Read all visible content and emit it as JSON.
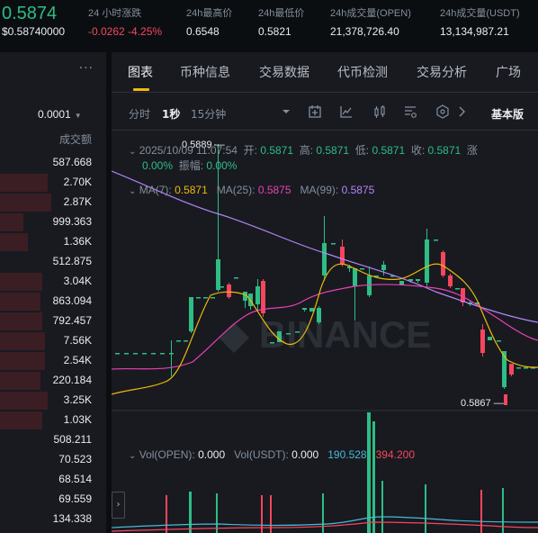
{
  "header": {
    "last_price": "0.5874",
    "last_price_usd": "$0.58740000",
    "stats": [
      {
        "label": "24 小时涨跌",
        "value": "-0.0262 -4.25%",
        "color": "#f6465d"
      },
      {
        "label": "24h最高价",
        "value": "0.6548",
        "color": "#eaecef"
      },
      {
        "label": "24h最低价",
        "value": "0.5821",
        "color": "#eaecef"
      },
      {
        "label": "24h成交量(OPEN)",
        "value": "21,378,726.40",
        "color": "#eaecef"
      },
      {
        "label": "24h成交量(USDT)",
        "value": "13,134,987.21",
        "color": "#eaecef"
      }
    ]
  },
  "orderbook": {
    "more_icon": "ellipsis-icon",
    "tick_size": "0.0001",
    "column_header": "成交额",
    "rows": [
      {
        "value": "587.668",
        "bar": 0.0,
        "side": "ask"
      },
      {
        "value": "2.70K",
        "bar": 0.45,
        "side": "ask"
      },
      {
        "value": "2.87K",
        "bar": 0.48,
        "side": "ask"
      },
      {
        "value": "999.363",
        "bar": 0.22,
        "side": "ask"
      },
      {
        "value": "1.36K",
        "bar": 0.26,
        "side": "ask"
      },
      {
        "value": "512.875",
        "bar": 0.0,
        "side": "ask"
      },
      {
        "value": "3.04K",
        "bar": 0.4,
        "side": "ask"
      },
      {
        "value": "863.094",
        "bar": 0.38,
        "side": "ask"
      },
      {
        "value": "792.457",
        "bar": 0.4,
        "side": "ask"
      },
      {
        "value": "7.56K",
        "bar": 0.42,
        "side": "ask"
      },
      {
        "value": "2.54K",
        "bar": 0.42,
        "side": "ask"
      },
      {
        "value": "220.184",
        "bar": 0.38,
        "side": "ask"
      },
      {
        "value": "3.25K",
        "bar": 0.45,
        "side": "ask"
      },
      {
        "value": "1.03K",
        "bar": 0.4,
        "side": "ask"
      },
      {
        "value": "508.211",
        "bar": 0.0,
        "side": "ask"
      },
      {
        "value": "70.523",
        "bar": 0.0,
        "side": "ask"
      },
      {
        "value": "68.514",
        "bar": 0.0,
        "side": "ask"
      },
      {
        "value": "69.559",
        "bar": 0.0,
        "side": "ask"
      },
      {
        "value": "134.338",
        "bar": 0.0,
        "side": "ask"
      }
    ]
  },
  "chart_panel": {
    "tabs": [
      "图表",
      "币种信息",
      "交易数据",
      "代币检测",
      "交易分析",
      "广场"
    ],
    "active_tab": "图表",
    "intervals": [
      "分时",
      "1秒",
      "15分钟"
    ],
    "active_interval": "1秒",
    "toolbar_icons": [
      "interval-dropdown-icon",
      "indicator-icon",
      "drawing-icon",
      "candlestick-type-icon",
      "settings-icon",
      "depth-icon",
      "expand-more-icon"
    ],
    "view_mode": "基本版",
    "ohlc": {
      "time": "2025/10/09 11:07:54",
      "open_label": "开:",
      "open": "0.5871",
      "high_label": "高:",
      "high": "0.5871",
      "low_label": "低:",
      "low": "0.5871",
      "close_label": "收:",
      "close": "0.5871",
      "change_label": "涨",
      "change": "0.00%",
      "amplitude_label": "振幅:",
      "amplitude": "0.00%"
    },
    "ma": [
      {
        "label": "MA(7):",
        "value": "0.5871",
        "color": "#f0b90b"
      },
      {
        "label": "MA(25):",
        "value": "0.5875",
        "color": "#eb40b5"
      },
      {
        "label": "MA(99):",
        "value": "0.5875",
        "color": "#b385f8"
      }
    ],
    "high_marker": "0.5889",
    "low_marker": "0.5867",
    "volume": [
      {
        "label": "Vol(OPEN):",
        "value": "0.000"
      },
      {
        "label": "Vol(USDT):",
        "value": "0.000"
      },
      {
        "label": "",
        "value": "190.528",
        "color": "#49b9d6"
      },
      {
        "label": "",
        "value": "394.200",
        "color": "#f6465d"
      }
    ],
    "scroll_left_label": "›"
  }
}
